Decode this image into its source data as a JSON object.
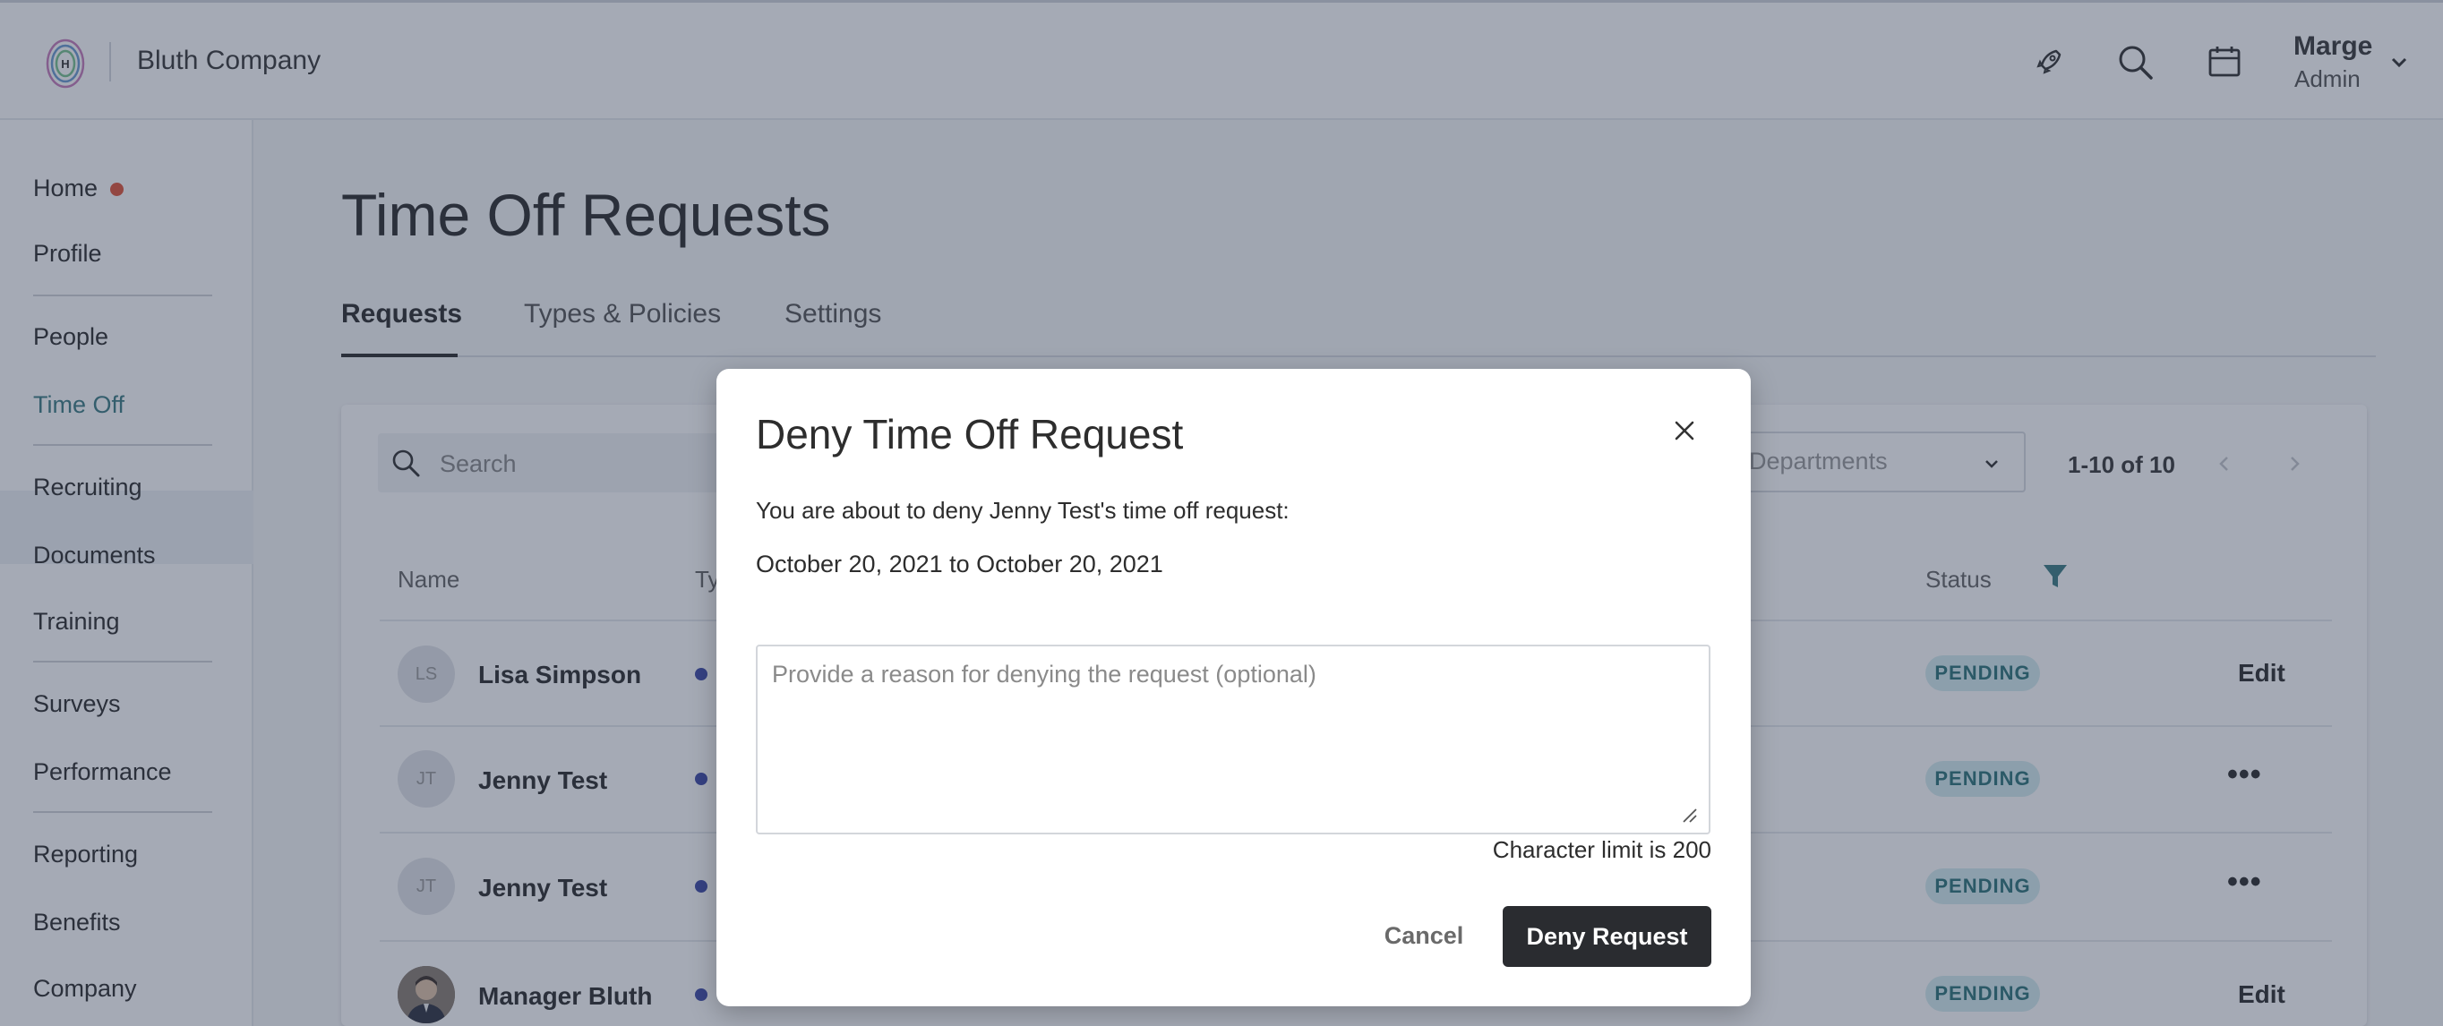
{
  "header": {
    "company_name": "Bluth Company",
    "user_name": "Marge",
    "user_role": "Admin"
  },
  "sidebar": {
    "items": [
      {
        "label": "Home"
      },
      {
        "label": "Profile"
      },
      {
        "label": "People"
      },
      {
        "label": "Time Off"
      },
      {
        "label": "Recruiting"
      },
      {
        "label": "Documents"
      },
      {
        "label": "Training"
      },
      {
        "label": "Surveys"
      },
      {
        "label": "Performance"
      },
      {
        "label": "Reporting"
      },
      {
        "label": "Benefits"
      },
      {
        "label": "Company"
      }
    ]
  },
  "page": {
    "title": "Time Off Requests",
    "tabs": [
      {
        "label": "Requests"
      },
      {
        "label": "Types & Policies"
      },
      {
        "label": "Settings"
      }
    ]
  },
  "toolbar": {
    "search_placeholder": "Search",
    "departments_placeholder": "Departments",
    "pagination": "1-10 of 10"
  },
  "table": {
    "columns": {
      "name": "Name",
      "type": "Ty",
      "status": "Status"
    },
    "rows": [
      {
        "initials": "LS",
        "name": "Lisa Simpson",
        "status": "PENDING",
        "action": "Edit"
      },
      {
        "initials": "JT",
        "name": "Jenny Test",
        "status": "PENDING",
        "action": "•••"
      },
      {
        "initials": "JT",
        "name": "Jenny Test",
        "status": "PENDING",
        "action": "•••"
      },
      {
        "initials": "",
        "name": "Manager Bluth",
        "status": "PENDING",
        "action": "Edit"
      }
    ]
  },
  "modal": {
    "title": "Deny Time Off Request",
    "message": "You are about to deny Jenny Test's time off request:",
    "dates": "October 20, 2021 to October 20, 2021",
    "reason_placeholder": "Provide a reason for denying the request (optional)",
    "reason_value": "",
    "char_limit": "Character limit is 200",
    "cancel_label": "Cancel",
    "deny_label": "Deny Request"
  },
  "colors": {
    "accent": "#3d7d83",
    "home_notification": "#e0553a",
    "primary_button": "#2a2c30",
    "status_pending_bg": "#d5ecef",
    "type_dot": "#3f4ba8"
  }
}
